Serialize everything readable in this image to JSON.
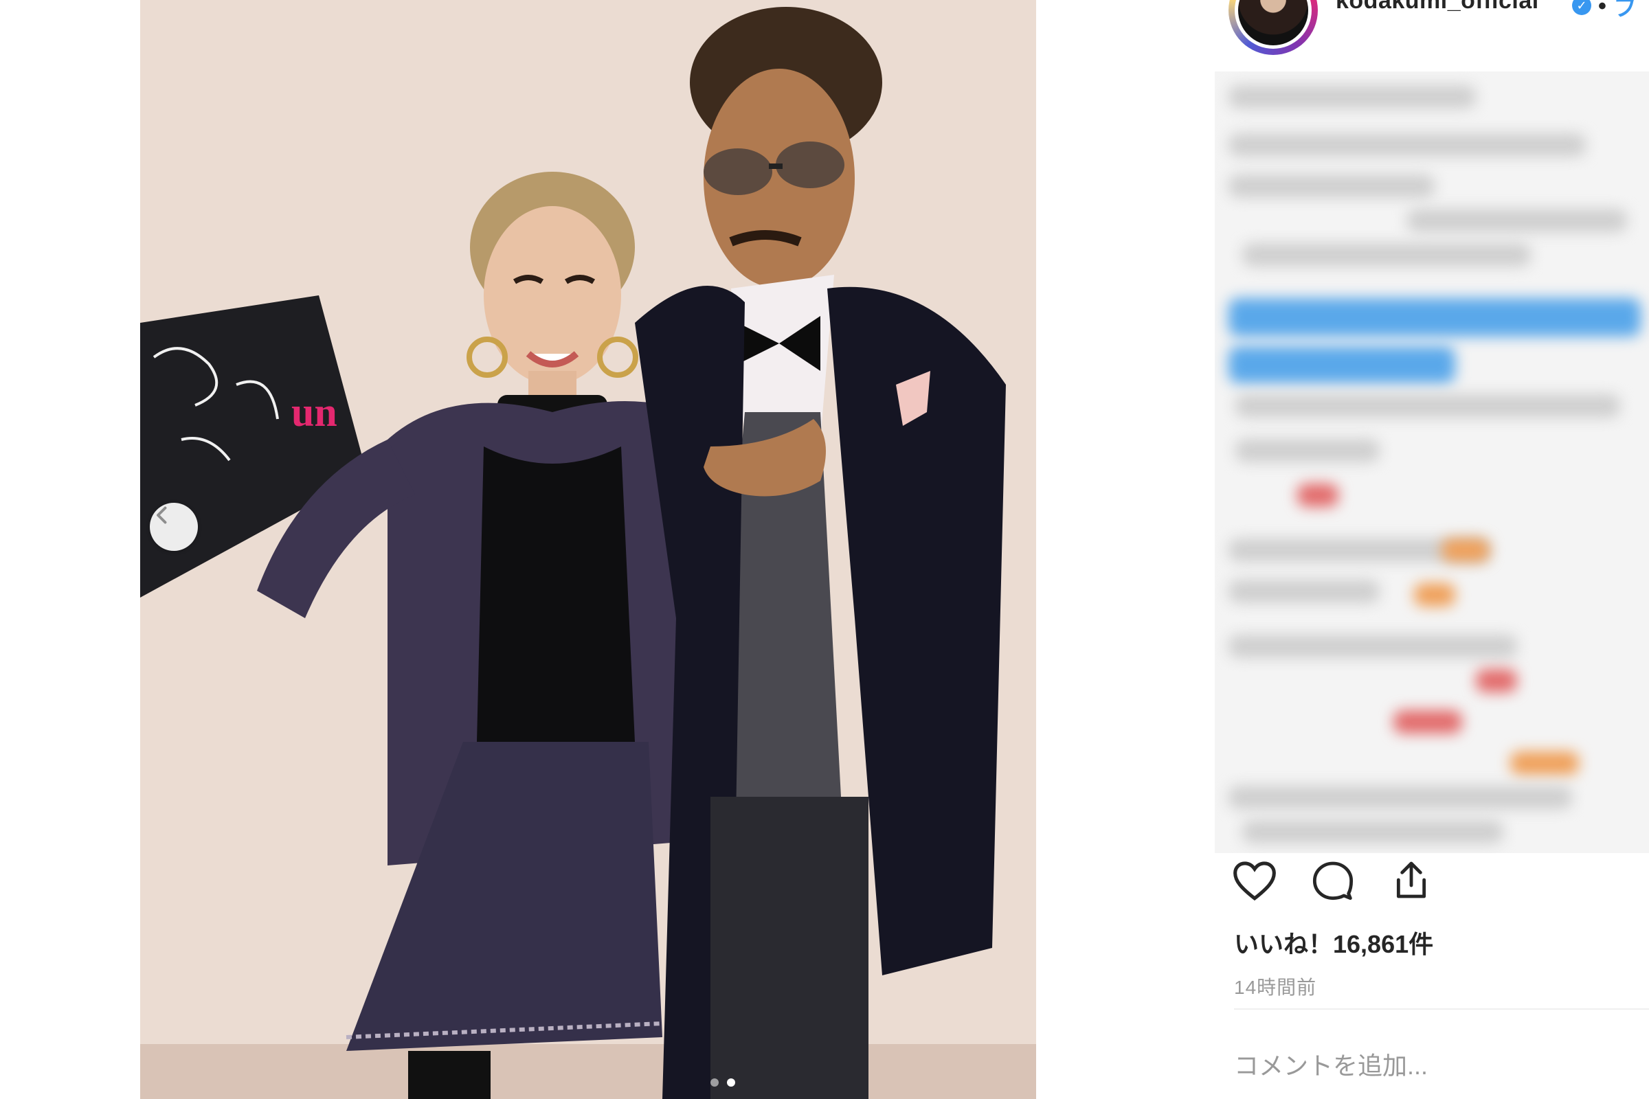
{
  "post": {
    "username": "kodakumi_official",
    "separator": "•",
    "follow_label": "フ",
    "likes_text": "いいね！16,861件",
    "time_ago": "14時間前"
  },
  "comment": {
    "placeholder": "コメントを追加..."
  },
  "carousel": {
    "total_slides": 2,
    "active_slide": 2
  },
  "icons": {
    "prev": "chevron-left-icon",
    "like": "heart-icon",
    "comment": "comment-bubble-icon",
    "share": "share-icon",
    "verified": "verified-badge-icon"
  },
  "colors": {
    "accent": "#3897f0",
    "text": "#262626",
    "muted": "#999999"
  }
}
